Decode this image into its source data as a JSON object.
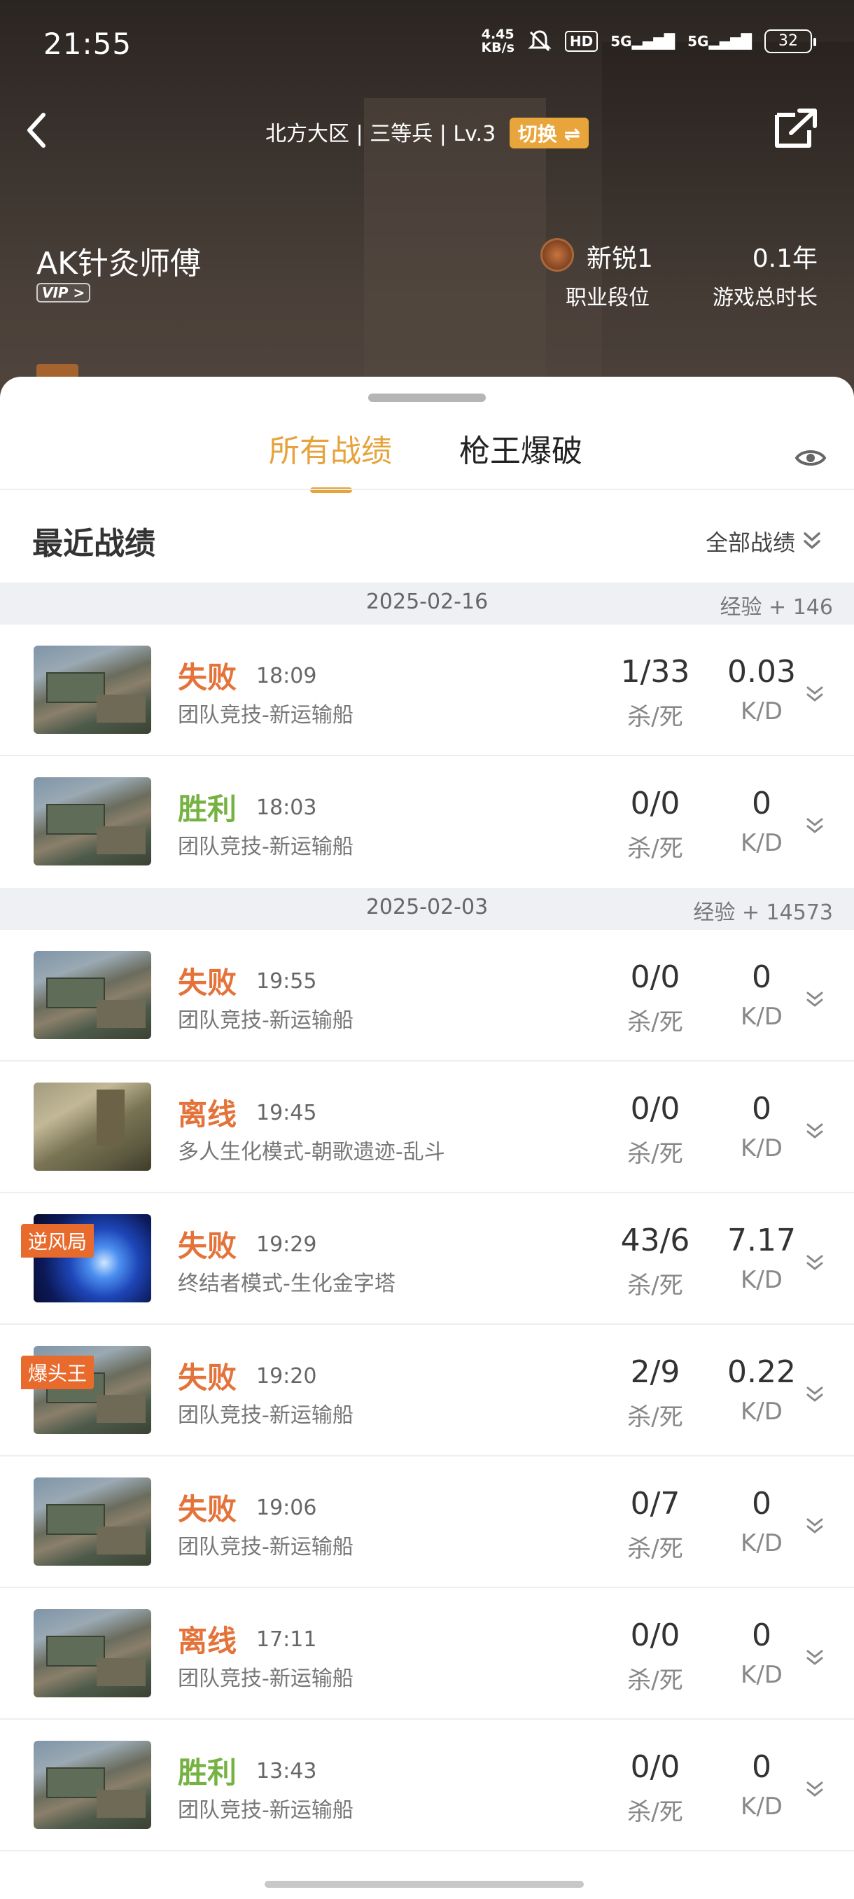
{
  "status_bar": {
    "time": "21:55",
    "net_speed_top": "4.45",
    "net_speed_bottom": "KB/s",
    "hd": "HD",
    "signal1": "5G",
    "signal2": "5G",
    "battery": "32"
  },
  "header": {
    "server_info": "北方大区 | 三等兵 | Lv.3",
    "switch_label": "切换 ⇌",
    "player_name": "AK针灸师傅",
    "vip_label": "VIP >",
    "rank_value": "新锐1",
    "rank_label": "职业段位",
    "play_time_value": "0.1年",
    "play_time_label": "游戏总时长"
  },
  "tabs": [
    {
      "label": "所有战绩",
      "active": true
    },
    {
      "label": "枪王爆破",
      "active": false
    }
  ],
  "section": {
    "title": "最近战绩",
    "filter_label": "全部战绩"
  },
  "kd_labels": {
    "kills_deaths": "杀/死",
    "kd": "K/D"
  },
  "dates": [
    {
      "date": "2025-02-16",
      "exp": "经验 + 146"
    },
    {
      "date": "2025-02-03",
      "exp": "经验 + 14573"
    }
  ],
  "matches": [
    {
      "result": "失败",
      "time": "18:09",
      "mode": "团队竞技-新运输船",
      "ks": "1/33",
      "kd": "0.03",
      "tag": ""
    },
    {
      "result": "胜利",
      "time": "18:03",
      "mode": "团队竞技-新运输船",
      "ks": "0/0",
      "kd": "0",
      "tag": ""
    },
    {
      "result": "失败",
      "time": "19:55",
      "mode": "团队竞技-新运输船",
      "ks": "0/0",
      "kd": "0",
      "tag": ""
    },
    {
      "result": "离线",
      "time": "19:45",
      "mode": "多人生化模式-朝歌遗迹-乱斗",
      "ks": "0/0",
      "kd": "0",
      "tag": ""
    },
    {
      "result": "失败",
      "time": "19:29",
      "mode": "终结者模式-生化金字塔",
      "ks": "43/6",
      "kd": "7.17",
      "tag": "逆风局"
    },
    {
      "result": "失败",
      "time": "19:20",
      "mode": "团队竞技-新运输船",
      "ks": "2/9",
      "kd": "0.22",
      "tag": "爆头王"
    },
    {
      "result": "失败",
      "time": "19:06",
      "mode": "团队竞技-新运输船",
      "ks": "0/7",
      "kd": "0",
      "tag": ""
    },
    {
      "result": "离线",
      "time": "17:11",
      "mode": "团队竞技-新运输船",
      "ks": "0/0",
      "kd": "0",
      "tag": ""
    },
    {
      "result": "胜利",
      "time": "13:43",
      "mode": "团队竞技-新运输船",
      "ks": "0/0",
      "kd": "0",
      "tag": ""
    }
  ],
  "colors": {
    "accent": "#e6a33c",
    "loss": "#e4733a",
    "win": "#76b241",
    "tag": "#e86a2c"
  },
  "icons": [
    "back-arrow-icon",
    "share-icon",
    "eye-icon",
    "chevron-down-icon",
    "rank-badge-icon",
    "bell-muted-icon"
  ]
}
